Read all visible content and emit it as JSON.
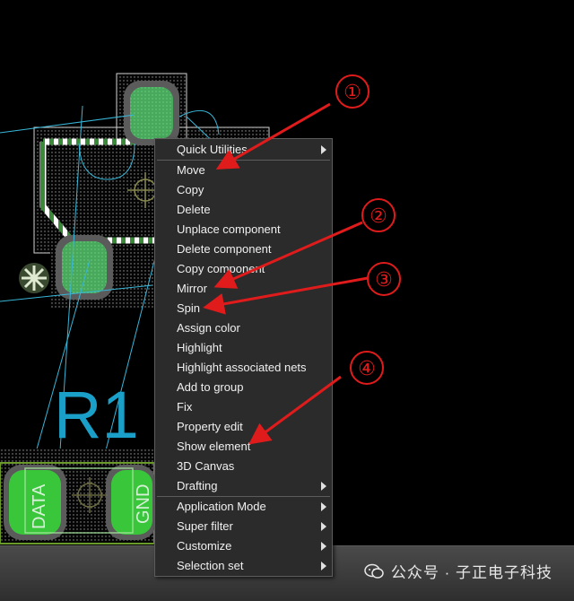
{
  "pcb": {
    "designator": "R1",
    "pad_labels": [
      "DATA",
      "GND"
    ]
  },
  "context_menu": {
    "items": [
      {
        "label": "Quick Utilities",
        "submenu": true
      },
      {
        "label": "Move",
        "submenu": false
      },
      {
        "label": "Copy",
        "submenu": false
      },
      {
        "label": "Delete",
        "submenu": false
      },
      {
        "label": "Unplace component",
        "submenu": false
      },
      {
        "label": "Delete component",
        "submenu": false
      },
      {
        "label": "Copy component",
        "submenu": false
      },
      {
        "label": "Mirror",
        "submenu": false
      },
      {
        "label": "Spin",
        "submenu": false
      },
      {
        "label": "Assign color",
        "submenu": false
      },
      {
        "label": "Highlight",
        "submenu": false
      },
      {
        "label": "Highlight associated nets",
        "submenu": false
      },
      {
        "label": "Add to group",
        "submenu": false
      },
      {
        "label": "Fix",
        "submenu": false
      },
      {
        "label": "Property edit",
        "submenu": false
      },
      {
        "label": "Show element",
        "submenu": false
      },
      {
        "label": "3D Canvas",
        "submenu": false
      },
      {
        "label": "Drafting",
        "submenu": true
      },
      {
        "label": "Application Mode",
        "submenu": true
      },
      {
        "label": "Super filter",
        "submenu": true
      },
      {
        "label": "Customize",
        "submenu": true
      },
      {
        "label": "Selection set",
        "submenu": true
      }
    ]
  },
  "annotations": {
    "markers": [
      "①",
      "②",
      "③",
      "④"
    ],
    "color": "#e01b1b"
  },
  "watermark": {
    "text": "公众号 · 子正电子科技"
  },
  "colors": {
    "pad_green": "#5fe07a",
    "ratsnest": "#38b6d8",
    "silkscreen": "#ffffff",
    "designator": "#1aa0c8"
  }
}
